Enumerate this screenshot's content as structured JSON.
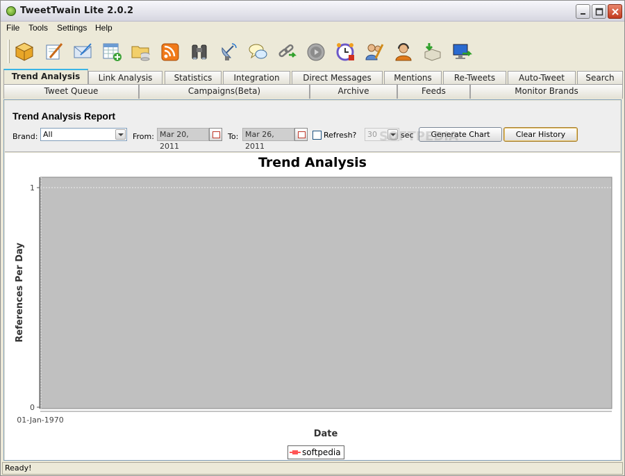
{
  "window": {
    "title": "TweetTwain Lite 2.0.2"
  },
  "menu": [
    "File",
    "Tools",
    "Settings",
    "Help"
  ],
  "toolbar": {
    "icons": [
      "package-icon",
      "compose-icon",
      "mail-icon",
      "calendar-add-icon",
      "folder-db-icon",
      "rss-icon",
      "binoculars-icon",
      "satellite-icon",
      "chat-bubbles-icon",
      "link-icon",
      "media-player-icon",
      "alarm-clock-icon",
      "users-icon",
      "support-agent-icon",
      "import-icon",
      "monitor-export-icon"
    ]
  },
  "tabs": {
    "row1": [
      "Trend Analysis",
      "Link Analysis",
      "Statistics",
      "Integration",
      "Direct Messages",
      "Mentions",
      "Re-Tweets",
      "Auto-Tweet",
      "Search"
    ],
    "row2": [
      "Tweet Queue",
      "Campaigns(Beta)",
      "Archive",
      "Feeds",
      "Monitor Brands"
    ],
    "active": "Trend Analysis"
  },
  "report": {
    "title": "Trend Analysis Report",
    "brand_label": "Brand:",
    "brand_value": "All",
    "from_label": "From:",
    "from_value": "Mar 20, 2011",
    "to_label": "To:",
    "to_value": "Mar 26, 2011",
    "refresh_label": "Refresh?",
    "refresh_value": "30",
    "refresh_unit": "sec",
    "generate_button": "Generate Chart",
    "clear_button": "Clear History"
  },
  "chart_data": {
    "type": "line",
    "title": "Trend Analysis",
    "xlabel": "Date",
    "ylabel": "References Per Day",
    "x_ticks": [
      "01-Jan-1970"
    ],
    "y_ticks": [
      0,
      1
    ],
    "ylim": [
      0,
      1
    ],
    "series": [
      {
        "name": "softpedia",
        "color": "#ff5555",
        "values": []
      }
    ],
    "plot_background": "#c0c0c0",
    "legend_position": "bottom-center",
    "grid": true
  },
  "status": {
    "text": "Ready!"
  }
}
